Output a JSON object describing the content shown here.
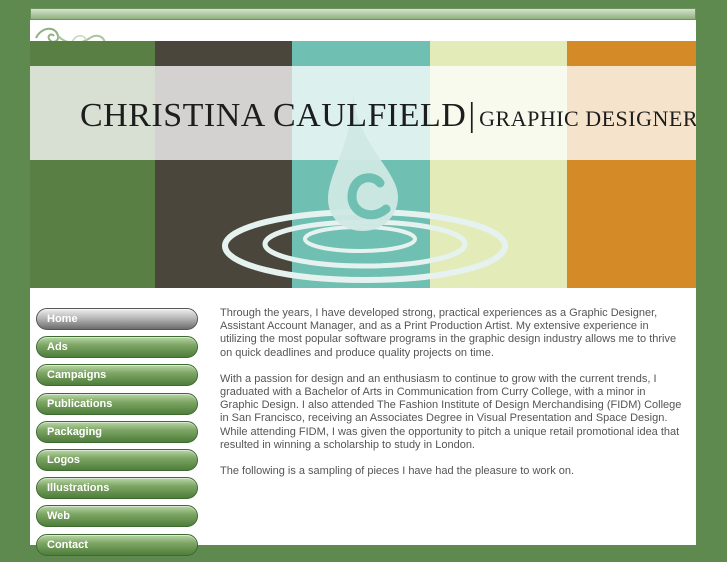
{
  "header": {
    "name": "CHRISTINA CAULFIELD",
    "separator": "|",
    "role": "GRAPHIC DESIGNER"
  },
  "colors": {
    "background": "#5e8a4f",
    "bands": [
      "#5a7f44",
      "#4a463c",
      "#6fbfb2",
      "#e3ebb8",
      "#d48a26"
    ]
  },
  "nav": {
    "items": [
      {
        "label": "Home",
        "active": true
      },
      {
        "label": "Ads"
      },
      {
        "label": "Campaigns"
      },
      {
        "label": "Publications"
      },
      {
        "label": "Packaging"
      },
      {
        "label": "Logos"
      },
      {
        "label": "Illustrations"
      },
      {
        "label": "Web"
      },
      {
        "label": "Contact"
      }
    ]
  },
  "content": {
    "paragraphs": [
      "Through the years, I have developed strong, practical experiences as a Graphic Designer, Assistant Account Manager, and as a Print Production Artist.  My extensive experience in utilizing the most popular software programs in the graphic design industry allows me to thrive on quick deadlines and produce quality projects on time.",
      "With a passion for design and an enthusiasm to continue to grow with the current trends, I graduated with a Bachelor of Arts in Communication from Curry College, with a minor in Graphic Design.  I also attended The Fashion Institute of Design Merchandising (FIDM) College in San Francisco, receiving an Associates Degree in Visual Presentation and Space Design. While attending FIDM, I was given the opportunity to pitch a unique retail promotional idea that resulted in winning a scholarship to study in London.",
      "The following is a sampling of pieces I have had the pleasure to work on."
    ]
  }
}
